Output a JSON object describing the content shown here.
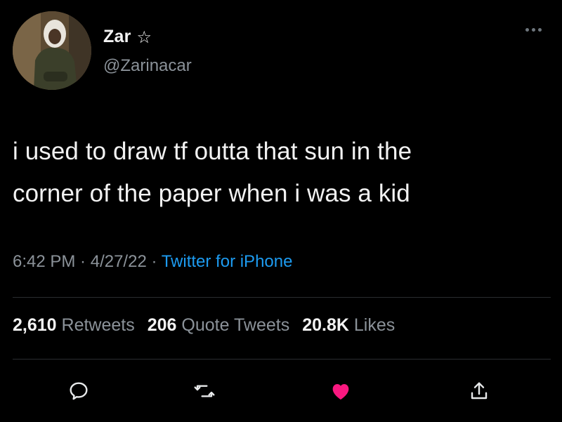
{
  "author": {
    "name": "Zar",
    "badge": "☆",
    "handle": "@Zarinacar"
  },
  "tweet": {
    "text_line1": "i used to draw tf outta that sun in the",
    "text_line2": "corner of the paper when i was a kid"
  },
  "meta": {
    "time": "6:42 PM",
    "separator": " · ",
    "date": "4/27/22",
    "source": "Twitter for iPhone"
  },
  "stats": {
    "retweets_count": "2,610",
    "retweets_label": "Retweets",
    "quotes_count": "206",
    "quotes_label": "Quote Tweets",
    "likes_count": "20.8K",
    "likes_label": "Likes"
  },
  "colors": {
    "background": "#000000",
    "text": "#f2f2f2",
    "secondary": "#8b9299",
    "link": "#1d9bf0",
    "like": "#f91880"
  },
  "icons": [
    "more-icon",
    "reply-icon",
    "retweet-icon",
    "like-icon",
    "share-icon"
  ]
}
